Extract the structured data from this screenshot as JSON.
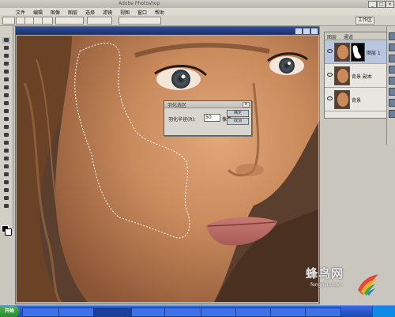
{
  "app": {
    "title": "Adobe Photoshop"
  },
  "window_controls": {
    "minimize": "_",
    "maximize": "□",
    "close": "×"
  },
  "menu": {
    "items": [
      "文件",
      "编辑",
      "图像",
      "图层",
      "选择",
      "滤镜",
      "视图",
      "窗口",
      "帮助"
    ]
  },
  "options_bar": {
    "right_button": "工作区"
  },
  "document": {
    "title": ""
  },
  "feather_dialog": {
    "title": "羽化选区",
    "radius_label": "羽化半径(R):",
    "radius_value": "50",
    "unit": "像素",
    "ok_label": "确定",
    "cancel_label": "取消",
    "close": "×"
  },
  "layers_panel": {
    "tabs": [
      "图层",
      "通道"
    ],
    "layers": [
      {
        "name": "图层 1",
        "active": true,
        "has_mask": true
      },
      {
        "name": "背景 副本",
        "active": false,
        "has_mask": false
      },
      {
        "name": "背景",
        "active": false,
        "has_mask": false
      }
    ]
  },
  "watermark": {
    "text": "蜂鸟网",
    "subtext": "fengniao.com"
  },
  "taskbar": {
    "start_label": "开始",
    "tasks": [
      "",
      "",
      "",
      "",
      "",
      "",
      "",
      "",
      ""
    ],
    "clock": ""
  },
  "colors": {
    "title_bar": "#16306a",
    "taskbar": "#1d49b8",
    "start_button": "#2c8a2f",
    "skin": "#c48556",
    "selection_marquee": "#ffffff"
  },
  "icons": {
    "close": "close-icon",
    "eye": "eye-icon",
    "marquee_tool": "marquee-tool-icon",
    "move_tool": "move-tool-icon"
  }
}
